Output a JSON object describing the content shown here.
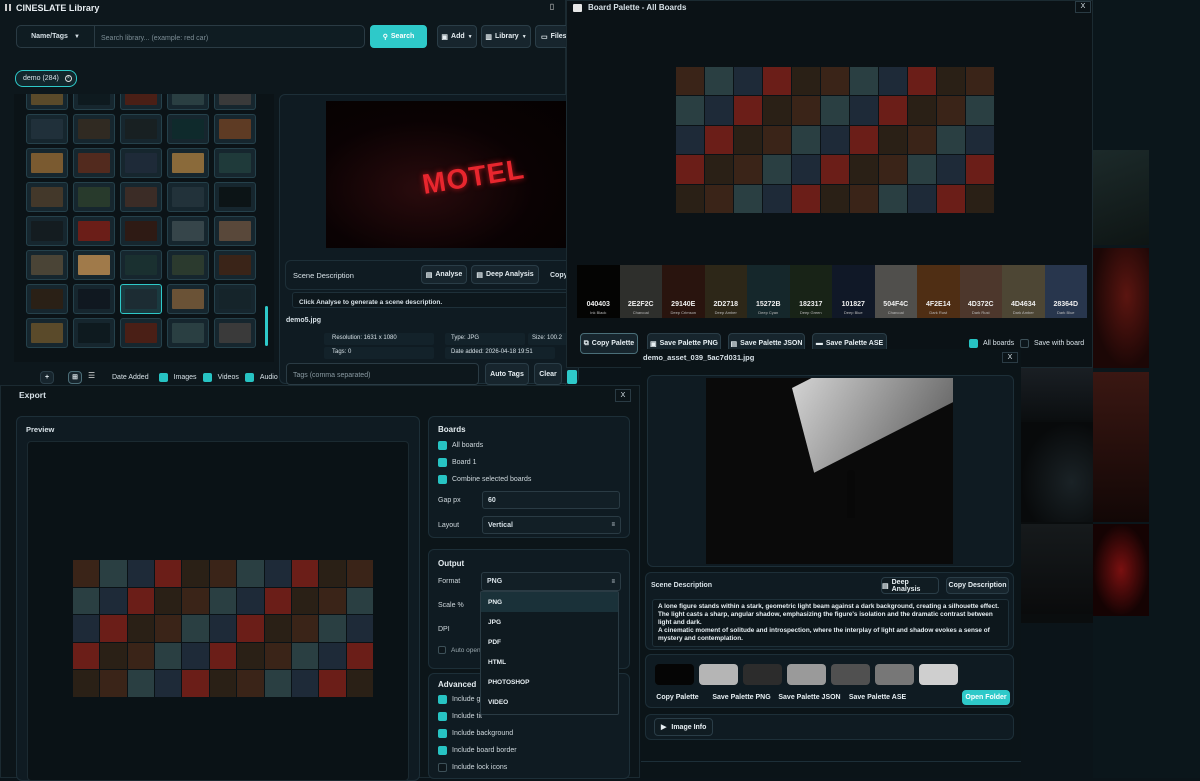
{
  "library": {
    "title": "CINESLATE Library",
    "filter_label": "Name/Tags",
    "search_placeholder": "Search library... (example: red car)",
    "search_button": "Search",
    "add_button": "Add",
    "library_button": "Library",
    "files_button": "Files",
    "tag_chip": "demo (284)",
    "footer": {
      "date_added": "Date Added",
      "images": "Images",
      "videos": "Videos",
      "audio": "Audio"
    },
    "preview": {
      "motel_text": "MOTEL",
      "scene_description_label": "Scene Description",
      "analyse": "Analyse",
      "deep_analysis": "Deep Analysis",
      "copy": "Copy",
      "placeholder": "Click Analyse to generate a scene description.",
      "filename": "demo5.jpg",
      "resolution": "Resolution: 1631 x 1080",
      "type": "Type: JPG",
      "size": "Size: 100.2",
      "tags": "Tags: 0",
      "date_added": "Date added: 2026-04-18 19:51",
      "tags_placeholder": "Tags (comma separated)",
      "auto_tags": "Auto Tags",
      "clear": "Clear"
    }
  },
  "board_palette": {
    "title": "Board Palette - All Boards",
    "close": "X",
    "swatches": [
      {
        "hex": "040403",
        "name": "Ink Black",
        "color": "#040403"
      },
      {
        "hex": "2E2F2C",
        "name": "Charcoal",
        "color": "#2E2F2C"
      },
      {
        "hex": "29140E",
        "name": "Deep Crimson",
        "color": "#29140E"
      },
      {
        "hex": "2D2718",
        "name": "Deep Amber",
        "color": "#2D2718"
      },
      {
        "hex": "15272B",
        "name": "Deep Cyan",
        "color": "#15272B"
      },
      {
        "hex": "182317",
        "name": "Deep Green",
        "color": "#182317"
      },
      {
        "hex": "101827",
        "name": "Deep Blue",
        "color": "#101827"
      },
      {
        "hex": "504F4C",
        "name": "Charcoal",
        "color": "#504F4C"
      },
      {
        "hex": "4F2E14",
        "name": "Dark Rust",
        "color": "#4F2E14"
      },
      {
        "hex": "4D372C",
        "name": "Dark Rust",
        "color": "#4D372C"
      },
      {
        "hex": "4D4634",
        "name": "Dark Amber",
        "color": "#4D4634"
      },
      {
        "hex": "28364D",
        "name": "Dark Blue",
        "color": "#28364D"
      }
    ],
    "copy_palette": "Copy Palette",
    "save_png": "Save Palette PNG",
    "save_json": "Save Palette JSON",
    "save_ase": "Save Palette ASE",
    "all_boards": "All boards",
    "save_with_board": "Save with board"
  },
  "asset": {
    "filename": "demo_asset_039_5ac7d031.jpg",
    "close": "X",
    "scene_description_label": "Scene Description",
    "deep_analysis": "Deep Analysis",
    "copy_description": "Copy Description",
    "description_1": "A lone figure stands within a stark, geometric light beam against a dark background, creating a silhouette effect. The light casts a sharp, angular shadow, emphasizing the figure's isolation and the dramatic contrast between light and dark.",
    "description_2": "A cinematic moment of solitude and introspection, where the interplay of light and shadow evokes a sense of mystery and contemplation.",
    "palette_colors": [
      "#050505",
      "#b5b5b5",
      "#2c2c2c",
      "#9a9a9a",
      "#505050",
      "#777777",
      "#cfcfcf"
    ],
    "copy_palette": "Copy Palette",
    "save_png": "Save Palette PNG",
    "save_json": "Save Palette JSON",
    "save_ase": "Save Palette ASE",
    "open_folder": "Open Folder",
    "image_info": "Image Info"
  },
  "export": {
    "title": "Export",
    "close": "X",
    "preview_label": "Preview",
    "boards": {
      "header": "Boards",
      "all_boards": "All boards",
      "board1": "Board 1",
      "combine": "Combine selected boards",
      "gap_label": "Gap px",
      "gap_value": "60",
      "layout_label": "Layout",
      "layout_value": "Vertical"
    },
    "output": {
      "header": "Output",
      "format_label": "Format",
      "format_value": "PNG",
      "scale_label": "Scale %",
      "dpi_label": "DPI",
      "auto_open": "Auto open",
      "options": [
        "PNG",
        "JPG",
        "PDF",
        "HTML",
        "PHOTOSHOP",
        "VIDEO"
      ]
    },
    "advanced": {
      "header": "Advanced",
      "include_gr": "Include gr",
      "include_tit": "Include tit",
      "include_background": "Include background",
      "include_board_border": "Include board border",
      "include_lock_icons": "Include lock icons"
    }
  },
  "colors": {
    "accent": "#2ec9c9",
    "motel": "#e8262e"
  }
}
